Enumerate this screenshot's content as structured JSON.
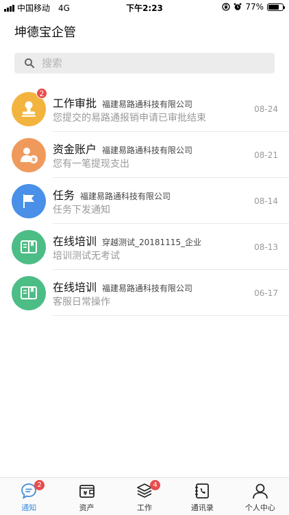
{
  "status_bar": {
    "carrier": "中国移动",
    "network": "4G",
    "time": "下午2:23",
    "battery": "77%",
    "battery_level": 0.77
  },
  "app": {
    "title": "坤德宝企管"
  },
  "search": {
    "placeholder": "搜索"
  },
  "messages": [
    {
      "title": "工作审批",
      "org": "福建易路通科技有限公司",
      "subtitle": "您提交的易路通报销申请已审批结束",
      "date": "08-24",
      "badge": "2",
      "icon": "stamp-icon",
      "color": "#f3b43f"
    },
    {
      "title": "资金账户",
      "org": "福建易路通科技有限公司",
      "subtitle": "您有一笔提现支出",
      "date": "08-21",
      "icon": "user-money-icon",
      "color": "#ef9a5c"
    },
    {
      "title": "任务",
      "org": "福建易路通科技有限公司",
      "subtitle": "任务下发通知",
      "date": "08-14",
      "icon": "flag-icon",
      "color": "#4a90e8"
    },
    {
      "title": "在线培训",
      "org": "穿越测试_20181115_企业",
      "subtitle": "培训测试无考试",
      "date": "08-13",
      "icon": "book-icon",
      "color": "#4dbd86"
    },
    {
      "title": "在线培训",
      "org": "福建易路通科技有限公司",
      "subtitle": "客服日常操作",
      "date": "06-17",
      "icon": "book-icon",
      "color": "#4dbd86"
    }
  ],
  "tabs": [
    {
      "label": "通知",
      "badge": "2",
      "icon": "chat-bubble-icon",
      "active": true
    },
    {
      "label": "资产",
      "icon": "wallet-icon"
    },
    {
      "label": "工作",
      "badge": "4",
      "icon": "layers-icon"
    },
    {
      "label": "通讯录",
      "icon": "contacts-book-icon"
    },
    {
      "label": "个人中心",
      "icon": "person-icon"
    }
  ],
  "colors": {
    "accent": "#3a8bdc",
    "badge": "#e84c4c"
  }
}
